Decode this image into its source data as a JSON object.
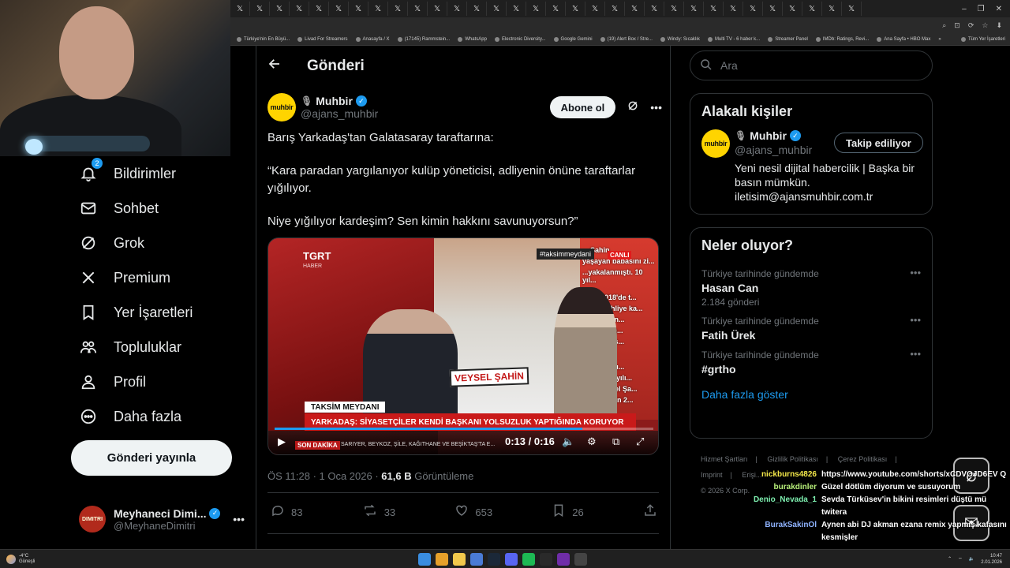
{
  "browser": {
    "tab_glyph": "𝕏",
    "window_controls": [
      "–",
      "❐",
      "✕"
    ],
    "addr_icons": [
      "⌕",
      "⊡",
      "⟳",
      "☆",
      "⬇"
    ],
    "bookmarks": [
      "Türkiye'nin En Büyü...",
      "Livad For Streamers",
      "Anasayfa / X",
      "(17145) Rammstein...",
      "WhatsApp",
      "Electronic Diversity...",
      "Google Gemini",
      "(19) Alert Box / Stre...",
      "Windy: Sıcaklık",
      "Multi TV - 6 haber k...",
      "Streamer Panel",
      "IMDb: Ratings, Revi...",
      "Ana Sayfa • HBO Max"
    ],
    "bookmarks_overflow": "»",
    "bookmarks_folder": "Tüm Yer İşaretleri"
  },
  "nav": {
    "notifications": "Bildirimler",
    "notifications_badge": "2",
    "messages": "Sohbet",
    "grok": "Grok",
    "premium": "Premium",
    "bookmarks": "Yer İşaretleri",
    "communities": "Topluluklar",
    "profile": "Profil",
    "more": "Daha fazla",
    "post_button": "Gönderi yayınla",
    "user": {
      "name": "Meyhaneci Dimi...",
      "handle": "@MeyhaneDimitri",
      "avatar_label": "DIMITRI"
    }
  },
  "main": {
    "title": "Gönderi",
    "author": {
      "logo": "muhbir",
      "name": "Muhbir",
      "handle": "@ajans_muhbir"
    },
    "follow_button": "Abone ol",
    "text": [
      "Barış Yarkadaş'tan Galatasaray taraftarına:",
      "“Kara paradan yargılanıyor kulüp yöneticisi, adliyenin önüne taraftarlar yığılıyor.",
      "Niye yığılıyor kardeşim? Sen kimin hakkını savunuyorsun?”"
    ],
    "video": {
      "channel": "TGRT",
      "channel_sub": "HABER",
      "hashtag": "#taksimmeydani",
      "live": "CANLI",
      "nameplate": "VEYSEL ŞAHİN",
      "red_text_lines": [
        "... Şahin",
        "yaşayan babasını zi...",
        "...yakalanmıştı. 10 yıl...",
        "023 - 2018'de t...",
        "...malı tahliye ka...",
        "...ial edilen...",
        "...namıyan...",
        "...ile ilgili s...",
        "3 - \"Yasadı...",
        "...an 2018 yılı...",
        "...an Veysel Şa...",
        "...iyle Nisan 2..."
      ],
      "lower_title": "TAKSİM MEYDANI",
      "lower_headline": "YARKADAŞ: SİYASETÇİLER KENDİ BAŞKANI YOLSUZLUK YAPTIĞINDA KORUYOR",
      "breaking": "SON DAKİKA",
      "ticker": "SARIYER, BEYKOZ, ŞİLE, KAĞITHANE VE BEŞİKTAŞ'TA E...",
      "time": "0:13 / 0:16",
      "progress": 0.8125
    },
    "meta": {
      "time": "ÖS 11:28 · 1 Oca 2026 · ",
      "views": "61,6 B",
      "views_label": " Görüntüleme"
    },
    "actions": {
      "replies": "83",
      "reposts": "33",
      "likes": "653",
      "bookmarks": "26"
    }
  },
  "right": {
    "search_placeholder": "Ara",
    "related_title": "Alakalı kişiler",
    "related": {
      "logo": "muhbir",
      "name": "Muhbir",
      "handle": "@ajans_muhbir",
      "bio": "Yeni nesil dijital habercilik | Başka bir basın mümkün. iletisim@ajansmuhbir.com.tr",
      "button": "Takip ediliyor"
    },
    "trends_title": "Neler oluyor?",
    "trends": [
      {
        "category": "Türkiye tarihinde gündemde",
        "name": "Hasan Can",
        "count": "2.184 gönderi"
      },
      {
        "category": "Türkiye tarihinde gündemde",
        "name": "Fatih Ürek",
        "count": ""
      },
      {
        "category": "Türkiye tarihinde gündemde",
        "name": "#grtho",
        "count": ""
      }
    ],
    "show_more": "Daha fazla göster",
    "footer": [
      "Hizmet Şartları",
      "|",
      "Gizlilik Politikası",
      "|",
      "Çerez Politikası",
      "|",
      "Imprint",
      "|",
      "Erişi...",
      "© 2026 X Corp."
    ]
  },
  "chat": [
    {
      "user": "nickburns4826",
      "color": "#f5e94a",
      "msg": "https://www.youtube.com/shorts/xCDVOJD6EV Q"
    },
    {
      "user": "burakdinler",
      "color": "#b8f07a",
      "msg": "Güzel dötlüm diyorum ve susuyorum"
    },
    {
      "user": "Denio_Nevada_1",
      "color": "#7ef0b0",
      "msg": "Sevda Türküsev'in bikini resimleri düştü mü twitera"
    },
    {
      "user": "BurakSakinOl",
      "color": "#8fb3ff",
      "msg": "Aynen abi DJ akman ezana remix yapmış kafasını kesmişler"
    }
  ],
  "taskbar": {
    "weather_temp": "-4°C",
    "weather_desc": "Güneşli",
    "clock_time": "10:47",
    "clock_date": "2.01.2026"
  }
}
